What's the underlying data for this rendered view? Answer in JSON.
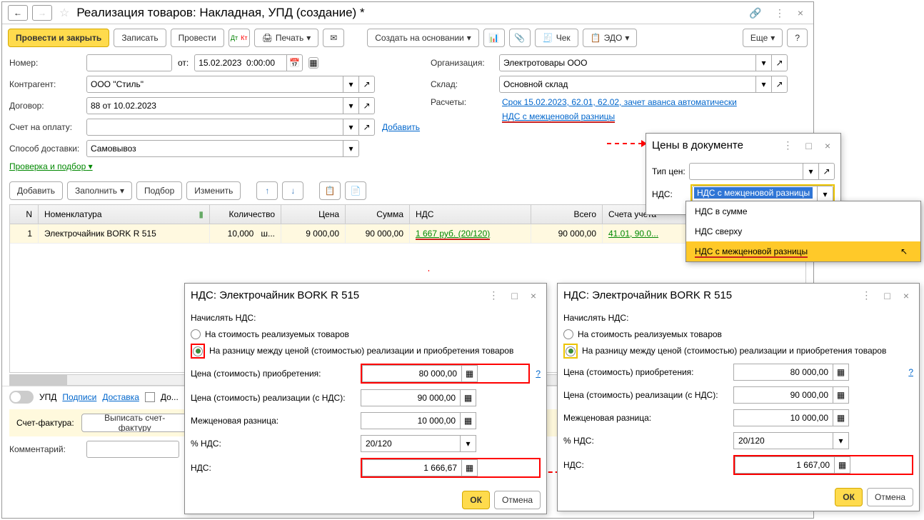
{
  "window": {
    "title": "Реализация товаров: Накладная, УПД (создание) *"
  },
  "toolbar": {
    "post_close": "Провести и закрыть",
    "save": "Записать",
    "post": "Провести",
    "print": "Печать",
    "create_based": "Создать на основании",
    "cheque": "Чек",
    "edo": "ЭДО",
    "more": "Еще",
    "help": "?"
  },
  "form": {
    "number_label": "Номер:",
    "number_value": "",
    "from_label": "от:",
    "date_value": "15.02.2023  0:00:00",
    "org_label": "Организация:",
    "org_value": "Электротовары ООО",
    "contragent_label": "Контрагент:",
    "contragent_value": "ООО \"Стиль\"",
    "warehouse_label": "Склад:",
    "warehouse_value": "Основной склад",
    "contract_label": "Договор:",
    "contract_value": "88 от 10.02.2023",
    "calc_label": "Расчеты:",
    "calc_link": "Срок 15.02.2023, 62.01, 62.02, зачет аванса автоматически",
    "invoice_label": "Счет на оплату:",
    "add_link": "Добавить",
    "vat_link": "НДС с межценовой разницы",
    "delivery_label": "Способ доставки:",
    "delivery_value": "Самовывоз",
    "check_link": "Проверка и подбор"
  },
  "tabbar": {
    "add": "Добавить",
    "fill": "Заполнить",
    "select": "Подбор",
    "edit": "Изменить"
  },
  "table": {
    "headers": {
      "n": "N",
      "nom": "Номенклатура",
      "qty": "Количество",
      "price": "Цена",
      "sum": "Сумма",
      "vat": "НДС",
      "total": "Всего",
      "acc": "Счета учета"
    },
    "row": {
      "n": "1",
      "nom": "Электрочайник BORK R 515",
      "qty": "10,000",
      "unit": "ш...",
      "price": "9 000,00",
      "sum": "90 000,00",
      "vat": "1 667 руб. (20/120)",
      "total": "90 000,00",
      "acc": "41.01, 90.0..."
    }
  },
  "bottom": {
    "upd": "УПД",
    "sign": "Подписи",
    "delivery": "Доставка",
    "do": "До...",
    "sf_label": "Счет-фактура:",
    "sf_btn": "Выписать счет-фактуру",
    "comment_label": "Комментарий:"
  },
  "popup_prices": {
    "title": "Цены в документе",
    "type_label": "Тип цен:",
    "vat_label": "НДС:",
    "vat_value": "НДС с межценовой разницы",
    "options": [
      "НДС в сумме",
      "НДС сверху",
      "НДС с межценовой разницы"
    ]
  },
  "popup_vat": {
    "title": "НДС: Электрочайник BORK R 515",
    "charge_label": "Начислять НДС:",
    "opt1": "На стоимость реализуемых товаров",
    "opt2": "На разницу между ценой (стоимостью) реализации и приобретения товаров",
    "price_acq_label": "Цена (стоимость) приобретения:",
    "price_acq_value": "80 000,00",
    "price_real_label": "Цена (стоимость) реализации (с НДС):",
    "price_real_value": "90 000,00",
    "diff_label": "Межценовая разница:",
    "diff_value": "10 000,00",
    "rate_label": "% НДС:",
    "rate_value": "20/120",
    "vat_amount_label": "НДС:",
    "vat_amount1": "1 666,67",
    "vat_amount2": "1 667,00",
    "ok": "ОК",
    "cancel": "Отмена"
  }
}
